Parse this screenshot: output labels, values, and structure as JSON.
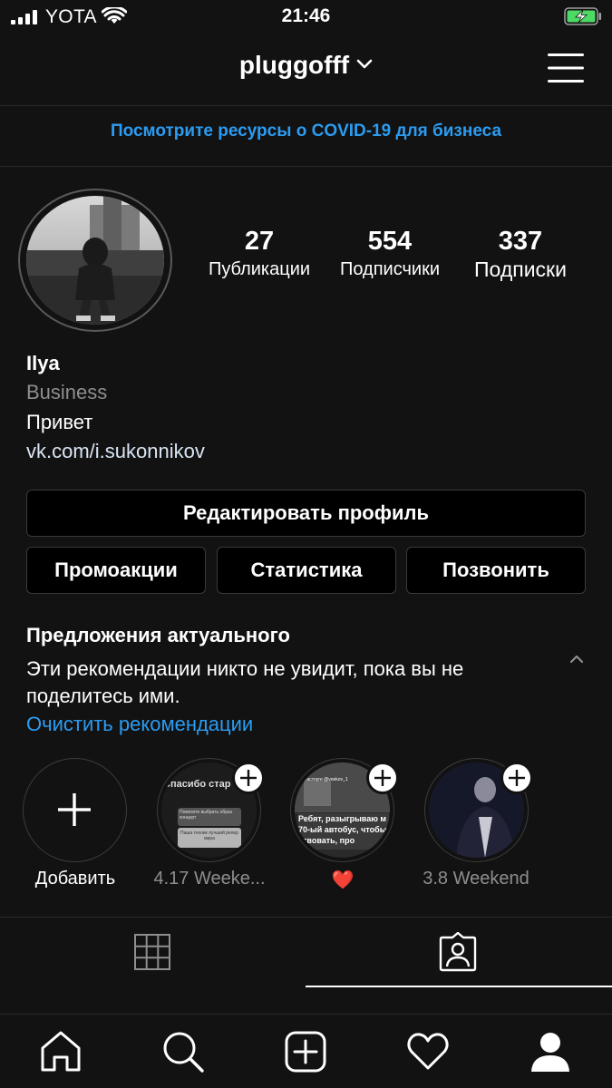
{
  "status_bar": {
    "carrier": "YOTA",
    "time": "21:46",
    "signal_icon": "signal-bars-icon",
    "wifi_icon": "wifi-icon",
    "battery_icon": "battery-charging-icon",
    "battery_color": "#4cd964"
  },
  "header": {
    "username": "pluggofff",
    "dropdown_icon": "chevron-down-icon",
    "menu_icon": "hamburger-menu-icon"
  },
  "banner": {
    "text": "Посмотрите ресурсы о COVID-19 для бизнеса",
    "color": "#2b9cf2"
  },
  "profile": {
    "stats": [
      {
        "count": "27",
        "label": "Публикации"
      },
      {
        "count": "554",
        "label": "Подписчики"
      },
      {
        "count": "337",
        "label": "Подписки"
      }
    ],
    "name": "Ilya",
    "category": "Business",
    "bio": "Привет",
    "link": "vk.com/i.sukonnikov"
  },
  "buttons": {
    "edit_profile": "Редактировать профиль",
    "promotions": "Промоакции",
    "insights": "Статистика",
    "call": "Позвонить"
  },
  "suggestions": {
    "title": "Предложения актуального",
    "description": "Эти рекомендации никто не увидит, пока вы не поделитесь ими.",
    "clear_link": "Очистить рекомендации"
  },
  "highlights": [
    {
      "label": "Добавить",
      "icon": "plus-icon"
    },
    {
      "label": "4.17 Weeke...",
      "thumb_text_1": "Спасибо стар",
      "thumb_text_2": "Помогите выбрать образ концерт",
      "thumb_text_3": "Паша техник лучший репер мира"
    },
    {
      "label": "❤️",
      "thumb_text_1": "тмеастоуге @voekov_1",
      "thumb_text_2": "Ребят, разыгрываю м 70-ый автобус, чтобы ствовать, про"
    },
    {
      "label": "3.8 Weekend"
    }
  ],
  "profile_tabs": {
    "grid_icon": "grid-icon",
    "tagged_icon": "tagged-person-icon",
    "active": "tagged"
  },
  "bottom_nav": {
    "items": [
      "home-icon",
      "search-icon",
      "new-post-icon",
      "activity-heart-icon",
      "profile-icon"
    ]
  },
  "colors": {
    "background": "#121212",
    "accent": "#2b9cf2",
    "secondary_text": "#8e8e8e"
  }
}
